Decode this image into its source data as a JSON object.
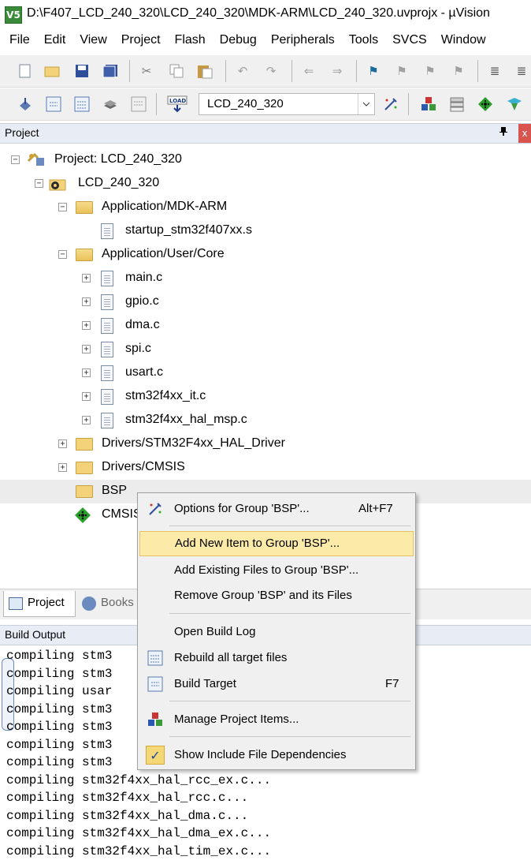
{
  "window": {
    "title": "D:\\F407_LCD_240_320\\LCD_240_320\\MDK-ARM\\LCD_240_320.uvprojx - µVision",
    "app_icon": "V5"
  },
  "menubar": [
    "File",
    "Edit",
    "View",
    "Project",
    "Flash",
    "Debug",
    "Peripherals",
    "Tools",
    "SVCS",
    "Window"
  ],
  "toolbar": {
    "target": "LCD_240_320",
    "load_label": "LOAD"
  },
  "project_panel": {
    "title": "Project",
    "pin": "ᵖ",
    "close": "x",
    "tree": {
      "project": "Project: LCD_240_320",
      "target": "LCD_240_320",
      "group_mdk": "Application/MDK-ARM",
      "file_startup": "startup_stm32f407xx.s",
      "group_core": "Application/User/Core",
      "files_core": [
        "main.c",
        "gpio.c",
        "dma.c",
        "spi.c",
        "usart.c",
        "stm32f4xx_it.c",
        "stm32f4xx_hal_msp.c"
      ],
      "group_hal": "Drivers/STM32F4xx_HAL_Driver",
      "group_cmsis": "Drivers/CMSIS",
      "group_bsp": "BSP",
      "cmsis_comp": "CMSIS"
    }
  },
  "tabs": {
    "project": "Project",
    "books": "Books"
  },
  "build_output": {
    "title": "Build Output",
    "lines": [
      "compiling stm3",
      "compiling stm3",
      "compiling usar",
      "compiling stm3",
      "compiling stm3",
      "compiling stm3",
      "compiling stm3",
      "compiling stm32f4xx_hal_rcc_ex.c...",
      "compiling stm32f4xx_hal_rcc.c...",
      "compiling stm32f4xx_hal_dma.c...",
      "compiling stm32f4xx_hal_dma_ex.c...",
      "compiling stm32f4xx_hal_tim_ex.c..."
    ]
  },
  "context_menu": {
    "options": "Options for Group 'BSP'...",
    "options_shortcut": "Alt+F7",
    "add_new": "Add New  Item to Group 'BSP'...",
    "add_existing": "Add Existing Files to Group 'BSP'...",
    "remove": "Remove Group 'BSP' and its Files",
    "open_log": "Open Build Log",
    "rebuild": "Rebuild all target files",
    "build": "Build Target",
    "build_shortcut": "F7",
    "manage": "Manage Project Items...",
    "show_deps": "Show Include File Dependencies",
    "check": "✓"
  },
  "colors": {
    "menu_highlight": "#fbeaa8",
    "header_bg": "#e8edf5",
    "close_red": "#d9534f"
  }
}
